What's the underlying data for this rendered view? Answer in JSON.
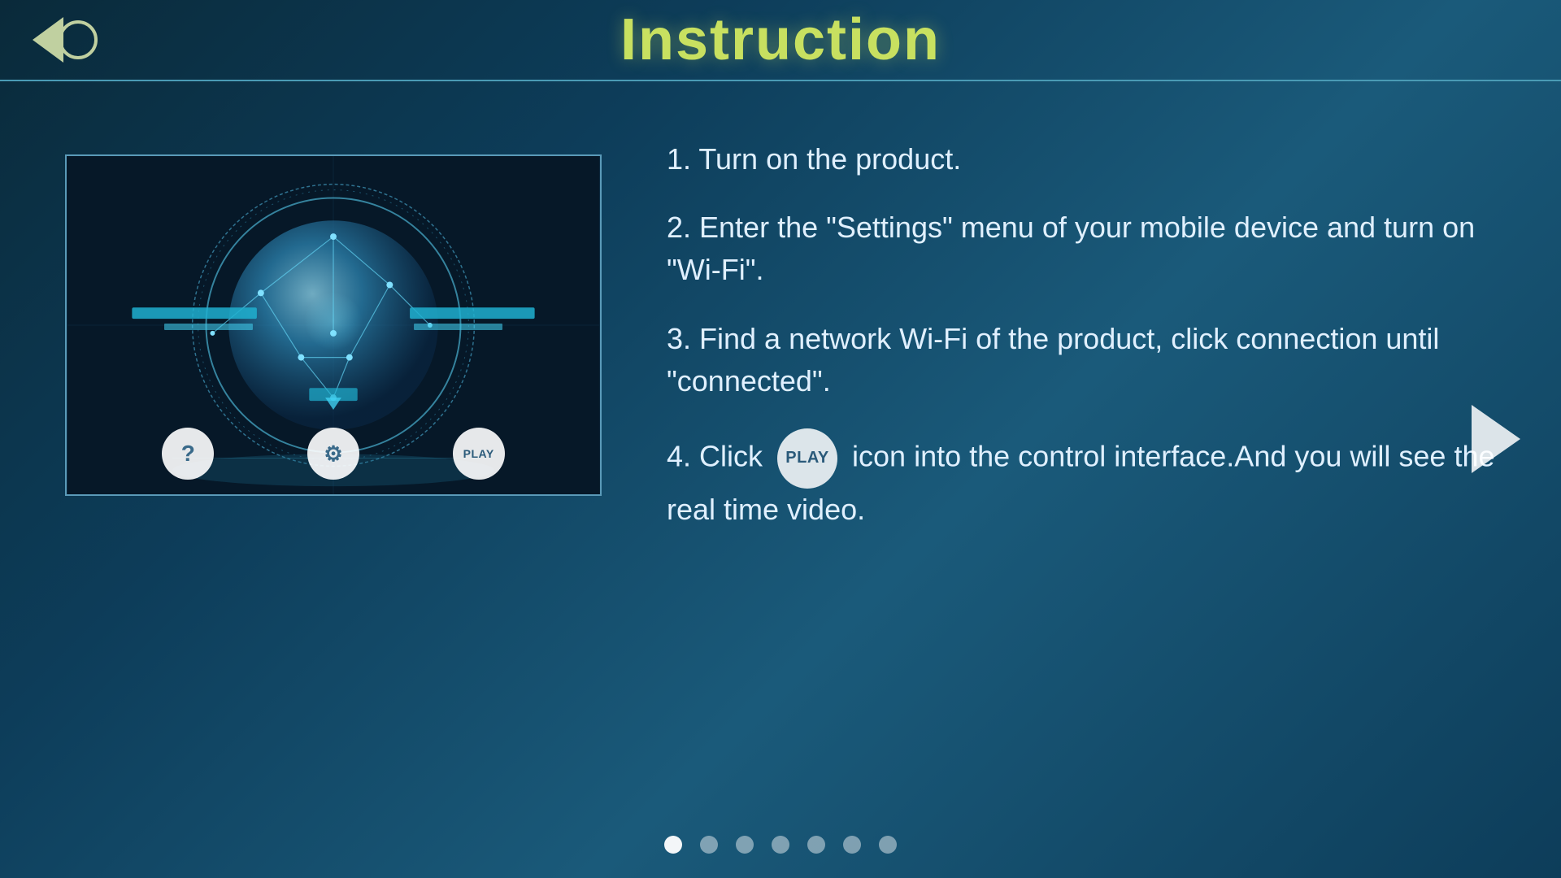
{
  "header": {
    "title": "Instruction",
    "back_label": "Back"
  },
  "instructions": {
    "items": [
      {
        "num": "1.",
        "text": " Turn on the product."
      },
      {
        "num": "2.",
        "text": " Enter the \"Settings\" menu of your mobile device and turn on \"Wi-Fi\"."
      },
      {
        "num": "3.",
        "text": " Find a network Wi-Fi of the product, click connection until \"connected\"."
      },
      {
        "num": "4.",
        "text": " Click  icon into the control interface.And you will see the real time video.",
        "has_play": true
      }
    ]
  },
  "device_icons": {
    "help": "?",
    "settings": "⚙",
    "play": "PLAY"
  },
  "pagination": {
    "total": 7,
    "active_index": 0
  },
  "next_arrow_label": "Next",
  "play_badge_text": "PLAY"
}
